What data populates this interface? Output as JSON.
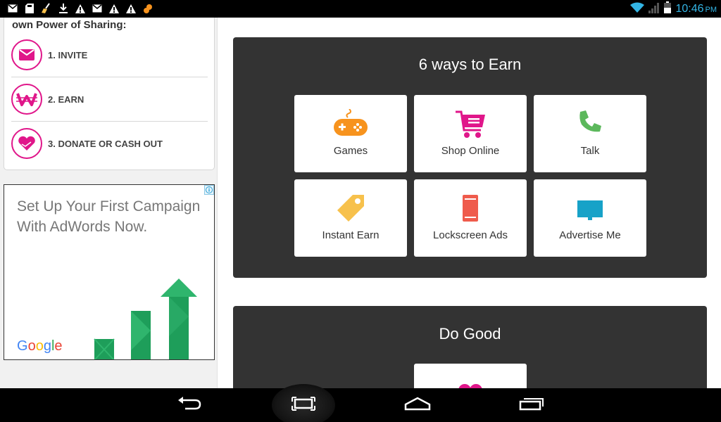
{
  "status_bar": {
    "notification_icons": [
      "gmail-icon",
      "sd-card-icon",
      "broom-icon",
      "download-icon",
      "warning-icon",
      "gmail-icon",
      "warning-icon",
      "warning-icon",
      "squirrel-icon"
    ],
    "time": "10:46",
    "ampm": "PM"
  },
  "share_card": {
    "title": "own Power of Sharing:",
    "steps": [
      {
        "label": "1. INVITE",
        "icon": "envelope-icon"
      },
      {
        "label": "2. EARN",
        "icon": "w-coin-icon"
      },
      {
        "label": "3. DONATE OR CASH OUT",
        "icon": "heart-hand-icon"
      }
    ]
  },
  "ad": {
    "text": "Set Up Your First Campaign With AdWords Now.",
    "brand_letters": [
      "G",
      "o",
      "o",
      "g",
      "l",
      "e"
    ]
  },
  "earn_panel": {
    "title": "6 ways to Earn",
    "tiles": [
      {
        "label": "Games",
        "icon": "gamepad-icon",
        "color": "#f7931e"
      },
      {
        "label": "Shop Online",
        "icon": "cart-icon",
        "color": "#e0168a"
      },
      {
        "label": "Talk",
        "icon": "phone-icon",
        "color": "#5cb85c"
      },
      {
        "label": "Instant Earn",
        "icon": "tag-icon",
        "color": "#f7c14c"
      },
      {
        "label": "Lockscreen Ads",
        "icon": "mobile-icon",
        "color": "#ef5b4c"
      },
      {
        "label": "Advertise Me",
        "icon": "screen-icon",
        "color": "#17a2c8"
      }
    ]
  },
  "good_panel": {
    "title": "Do Good"
  },
  "colors": {
    "brand_pink": "#e0168a",
    "panel_dark": "#333333",
    "clock_blue": "#33b5e5"
  },
  "nav_bar": {
    "buttons": [
      "back-icon",
      "screenshot-icon",
      "home-icon",
      "recents-icon"
    ]
  }
}
